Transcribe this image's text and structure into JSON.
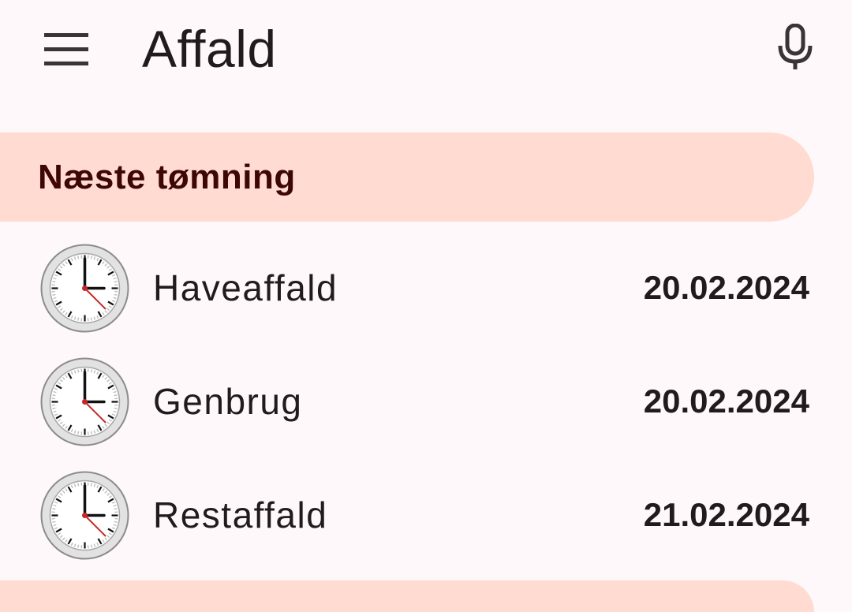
{
  "header": {
    "title": "Affald",
    "menu_icon": "menu-icon",
    "mic_icon": "microphone-icon"
  },
  "section": {
    "title": "Næste tømning"
  },
  "items": [
    {
      "icon": "clock-icon",
      "label": "Haveaffald",
      "date": "20.02.2024"
    },
    {
      "icon": "clock-icon",
      "label": "Genbrug",
      "date": "20.02.2024"
    },
    {
      "icon": "clock-icon",
      "label": "Restaffald",
      "date": "21.02.2024"
    }
  ],
  "colors": {
    "background": "#fff8fa",
    "section_header_bg": "#ffdbd1",
    "section_header_text": "#3d0706",
    "clock_hand_red": "#c62828"
  }
}
